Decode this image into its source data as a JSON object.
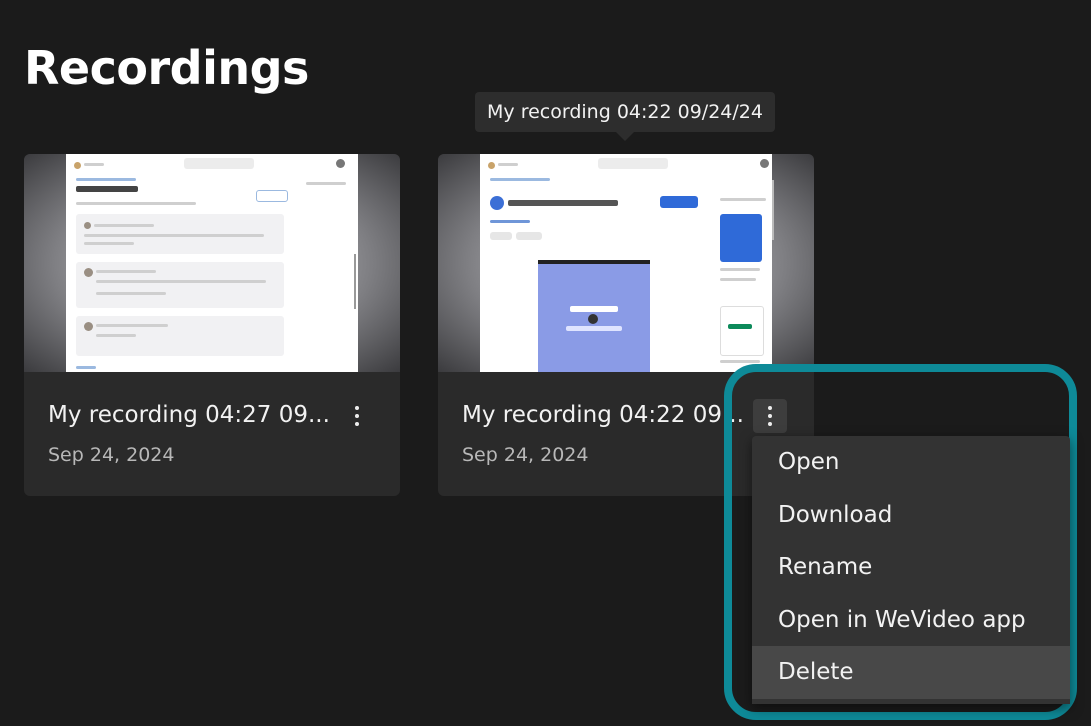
{
  "page": {
    "title": "Recordings"
  },
  "tooltip": {
    "text": "My recording 04:22 09/24/24"
  },
  "recordings": [
    {
      "title": "My recording 04:27 09...",
      "date": "Sep 24, 2024",
      "menu_icon": "kebab-icon"
    },
    {
      "title": "My recording 04:22 09...",
      "date": "Sep 24, 2024",
      "menu_icon": "kebab-icon"
    }
  ],
  "context_menu": {
    "items": [
      {
        "label": "Open"
      },
      {
        "label": "Download"
      },
      {
        "label": "Rename"
      },
      {
        "label": "Open in WeVideo app"
      },
      {
        "label": "Delete"
      }
    ],
    "hovered_index": 4
  },
  "colors": {
    "background": "#1b1b1b",
    "card": "#2a2a2a",
    "menu": "#333333",
    "highlight_ring": "#0e8a98"
  }
}
